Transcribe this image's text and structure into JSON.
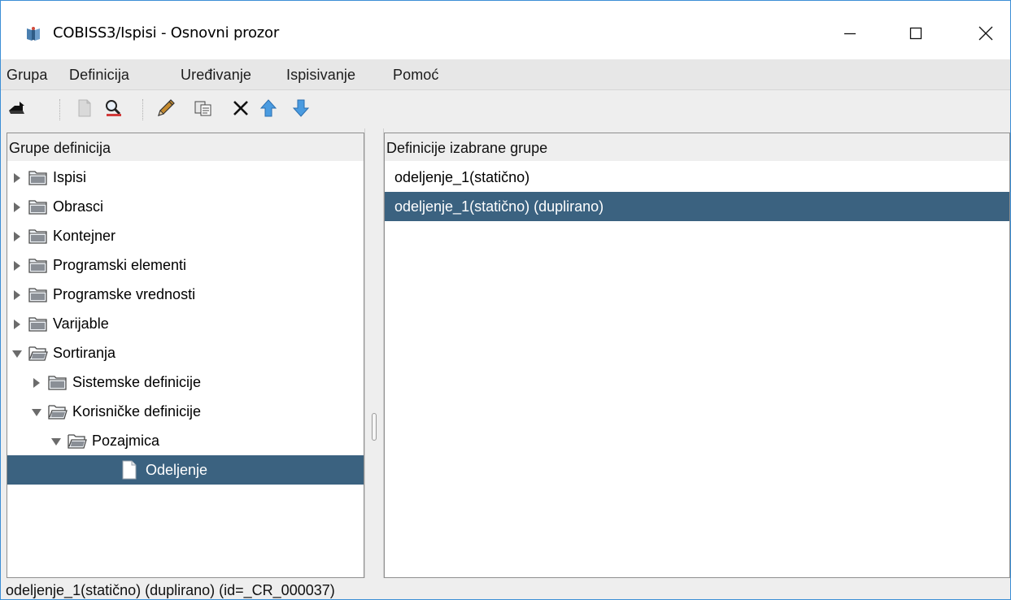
{
  "window": {
    "title": "COBISS3/Ispisi - Osnovni prozor",
    "controls": [
      "minimize-icon",
      "maximize-icon",
      "close-icon"
    ]
  },
  "menubar": {
    "items": [
      "Grupa",
      "Definicija",
      "Uređivanje",
      "Ispisivanje",
      "Pomoć"
    ]
  },
  "toolbar": {
    "icons": [
      "exit-door-icon",
      "new-document-icon",
      "search-icon",
      "edit-pencil-icon",
      "copy-icon",
      "delete-icon",
      "move-up-icon",
      "move-down-icon"
    ]
  },
  "left_panel": {
    "header": "Grupe definicija",
    "tree": [
      {
        "label": "Ispisi",
        "level": 0,
        "expanded": false,
        "type": "folder"
      },
      {
        "label": "Obrasci",
        "level": 0,
        "expanded": false,
        "type": "folder"
      },
      {
        "label": "Kontejner",
        "level": 0,
        "expanded": false,
        "type": "folder"
      },
      {
        "label": "Programski elementi",
        "level": 0,
        "expanded": false,
        "type": "folder"
      },
      {
        "label": "Programske vrednosti",
        "level": 0,
        "expanded": false,
        "type": "folder"
      },
      {
        "label": "Varijable",
        "level": 0,
        "expanded": false,
        "type": "folder"
      },
      {
        "label": "Sortiranja",
        "level": 0,
        "expanded": true,
        "type": "folder"
      },
      {
        "label": "Sistemske definicije",
        "level": 1,
        "expanded": false,
        "type": "folder"
      },
      {
        "label": "Korisničke definicije",
        "level": 1,
        "expanded": true,
        "type": "folder"
      },
      {
        "label": "Pozajmica",
        "level": 2,
        "expanded": true,
        "type": "folder"
      },
      {
        "label": "Odeljenje",
        "level": 3,
        "selected": true,
        "type": "document"
      }
    ]
  },
  "right_panel": {
    "header": "Definicije izabrane grupe",
    "items": [
      {
        "label": "odeljenje_1(statično)",
        "selected": false
      },
      {
        "label": "odeljenje_1(statično) (duplirano)",
        "selected": true
      }
    ]
  },
  "statusbar": {
    "text": "odeljenje_1(statično) (duplirano) (id=_CR_000037)"
  },
  "colors": {
    "selection": "#3b6280",
    "window_border": "#3c8fd6",
    "menubar_bg": "#e7e7e7",
    "panel_bg": "#eeeeee"
  }
}
